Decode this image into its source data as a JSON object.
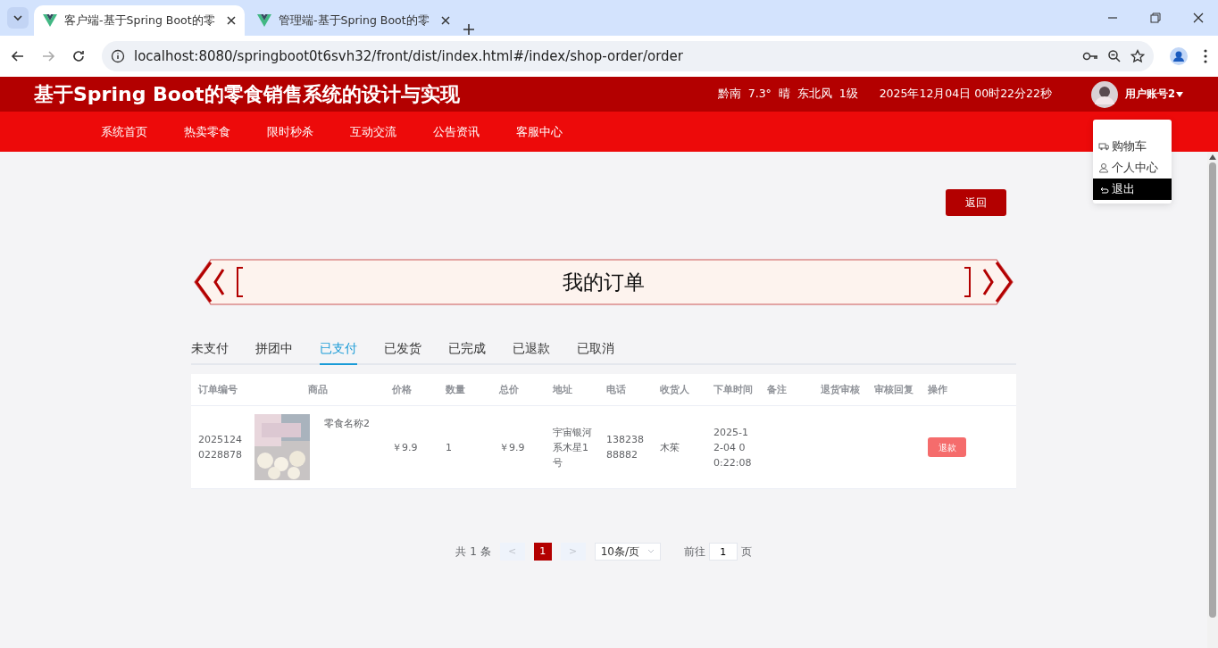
{
  "browser": {
    "tabs": [
      {
        "title": "客户端-基于Spring Boot的零",
        "selected": true
      },
      {
        "title": "管理端-基于Spring Boot的零",
        "selected": false
      }
    ],
    "url": "localhost:8080/springboot0t6svh32/front/dist/index.html#/index/shop-order/order"
  },
  "header": {
    "title": "基于Spring Boot的零食销售系统的设计与实现",
    "weather": "黔南  7.3°  晴  东北风  1级",
    "datetime": "2025年12月04日 00时22分22秒",
    "user": "用户账号2"
  },
  "nav": {
    "items": [
      "系统首页",
      "热卖零食",
      "限时秒杀",
      "互动交流",
      "公告资讯",
      "客服中心"
    ]
  },
  "user_menu": {
    "items": [
      {
        "label": "购物车",
        "kind": "cart",
        "highlighted": false
      },
      {
        "label": "个人中心",
        "kind": "user",
        "highlighted": false
      },
      {
        "label": "退出",
        "kind": "logout",
        "highlighted": true
      }
    ]
  },
  "back_button": "返回",
  "page_title": "我的订单",
  "status_tabs": [
    {
      "label": "未支付",
      "selected": false
    },
    {
      "label": "拼团中",
      "selected": false
    },
    {
      "label": "已支付",
      "selected": true
    },
    {
      "label": "已发货",
      "selected": false
    },
    {
      "label": "已完成",
      "selected": false
    },
    {
      "label": "已退款",
      "selected": false
    },
    {
      "label": "已取消",
      "selected": false
    }
  ],
  "table": {
    "columns": [
      "订单编号",
      "商品",
      "价格",
      "数量",
      "总价",
      "地址",
      "电话",
      "收货人",
      "下单时间",
      "备注",
      "退货审核",
      "审核回复",
      "操作"
    ],
    "rows": [
      {
        "order_no": "20251240228878",
        "product": {
          "kind": "picture",
          "name": "零食名称2"
        },
        "price": "￥9.9",
        "quantity": "1",
        "total": "￥9.9",
        "address": "宇宙银河系木星1号",
        "phone": "13823888882",
        "receiver": "木茱",
        "order_time": "2025-12-04 00:22:08",
        "action": "退款"
      }
    ]
  },
  "pagination": {
    "total": "共 1 条",
    "prev": "<",
    "pages": [
      {
        "label": "1",
        "selected": true
      }
    ],
    "next": ">",
    "page_size": "10条/页",
    "goto_label": "前往",
    "goto_value": "1",
    "goto_suffix": "页"
  }
}
